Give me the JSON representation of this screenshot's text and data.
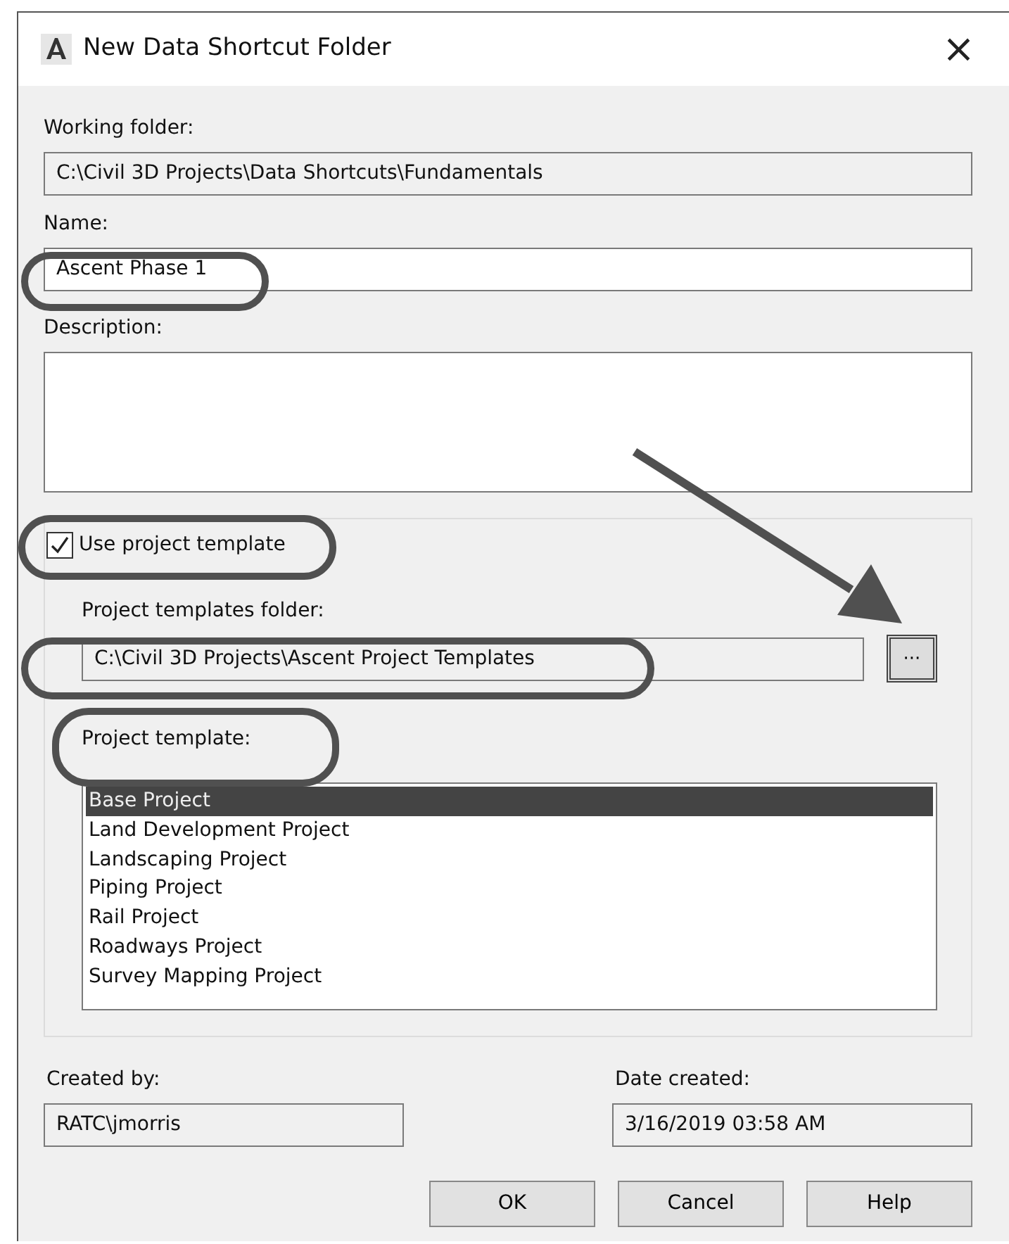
{
  "window": {
    "title": "New Data Shortcut Folder",
    "close": "×"
  },
  "working_folder": {
    "label": "Working folder:",
    "value": "C:\\Civil 3D Projects\\Data Shortcuts\\Fundamentals"
  },
  "name": {
    "label": "Name:",
    "value": "Ascent Phase 1"
  },
  "description": {
    "label": "Description:"
  },
  "use_project_template": {
    "label": "Use project template",
    "checked": true
  },
  "project_templates_folder": {
    "label": "Project templates folder:",
    "value": "C:\\Civil 3D Projects\\Ascent Project Templates",
    "browse": "···"
  },
  "project_template": {
    "label": "Project template:",
    "items": [
      {
        "label": "Base Project",
        "selected": true
      },
      {
        "label": "Land Development Project",
        "selected": false
      },
      {
        "label": "Landscaping Project",
        "selected": false
      },
      {
        "label": "Piping Project",
        "selected": false
      },
      {
        "label": "Rail Project",
        "selected": false
      },
      {
        "label": "Roadways Project",
        "selected": false
      },
      {
        "label": "Survey Mapping Project",
        "selected": false
      }
    ]
  },
  "created_by": {
    "label": "Created by:",
    "value": "RATC\\jmorris"
  },
  "date_created": {
    "label": "Date created:",
    "value": "3/16/2019 03:58 AM"
  },
  "buttons": [
    "OK",
    "Cancel",
    "Help"
  ]
}
